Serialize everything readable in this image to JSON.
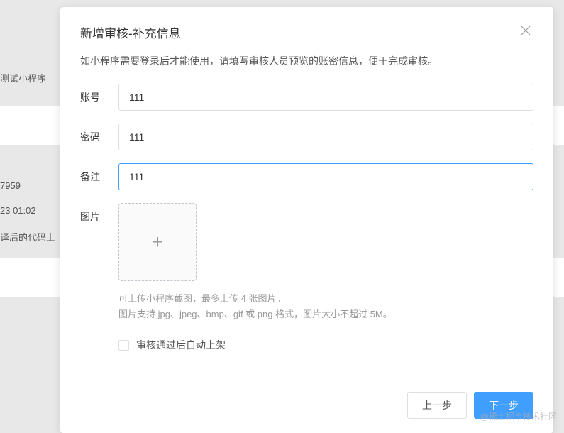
{
  "background": {
    "item1": "测试小程序",
    "item2": "7959",
    "item3": "23 01:02",
    "item4": "译后的代码上"
  },
  "modal": {
    "title": "新增审核-补充信息",
    "instruction": "如小程序需要登录后才能使用，请填写审核人员预览的账密信息，便于完成审核。",
    "fields": {
      "account": {
        "label": "账号",
        "value": "111"
      },
      "password": {
        "label": "密码",
        "value": "111"
      },
      "remark": {
        "label": "备注",
        "value": "111"
      },
      "image": {
        "label": "图片"
      }
    },
    "upload": {
      "hint1": "可上传小程序截图，最多上传 4 张图片。",
      "hint2": "图片支持 jpg、jpeg、bmp、gif 或 png 格式，图片大小不超过 5M。"
    },
    "checkbox": {
      "label": "审核通过后自动上架",
      "checked": false
    },
    "footer": {
      "prev": "上一步",
      "next": "下一步"
    }
  },
  "watermark": "@稀土掘金技术社区"
}
